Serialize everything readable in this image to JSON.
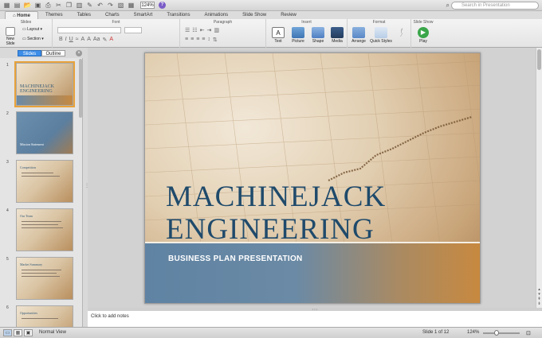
{
  "toolbar": {
    "icons": [
      "new-slide-icon",
      "open-icon",
      "save-icon",
      "print-icon",
      "cut-icon",
      "copy-icon",
      "paste-icon",
      "format-painter-icon",
      "undo-icon",
      "redo-icon",
      "gallery-icon",
      "presentation-icon",
      "slide-sorter-icon"
    ],
    "zoom": "124%",
    "help": "?",
    "search_placeholder": "Search in Presentation"
  },
  "tabs": [
    "Home",
    "Themes",
    "Tables",
    "Charts",
    "SmartArt",
    "Transitions",
    "Animations",
    "Slide Show",
    "Review"
  ],
  "active_tab": "Home",
  "ribbon": {
    "groups": {
      "slides": "Slides",
      "font": "Font",
      "paragraph": "Paragraph",
      "insert": "Insert",
      "format": "Format",
      "slideshow": "Slide Show"
    },
    "new_slide": "New Slide",
    "layout": "Layout",
    "section": "Section",
    "text": "Text",
    "picture": "Picture",
    "shape": "Shape",
    "media": "Media",
    "arrange": "Arrange",
    "quick_styles": "Quick Styles",
    "play": "Play"
  },
  "pane_tabs": {
    "slides": "Slides",
    "outline": "Outline"
  },
  "thumbnails": [
    {
      "num": "1",
      "title": "MACHINEJACK ENGINEERING"
    },
    {
      "num": "2",
      "title": "Mission Statement"
    },
    {
      "num": "3",
      "title": "Competition"
    },
    {
      "num": "4",
      "title": "Our Team"
    },
    {
      "num": "5",
      "title": "Market Summary"
    },
    {
      "num": "6",
      "title": "Opportunities"
    }
  ],
  "slide": {
    "title_line1": "MACHINEJACK",
    "title_line2": "ENGINEERING",
    "subtitle": "BUSINESS PLAN PRESENTATION"
  },
  "notes_placeholder": "Click to add notes",
  "status": {
    "view": "Normal View",
    "slide_counter": "Slide 1 of 12",
    "zoom": "124%"
  }
}
